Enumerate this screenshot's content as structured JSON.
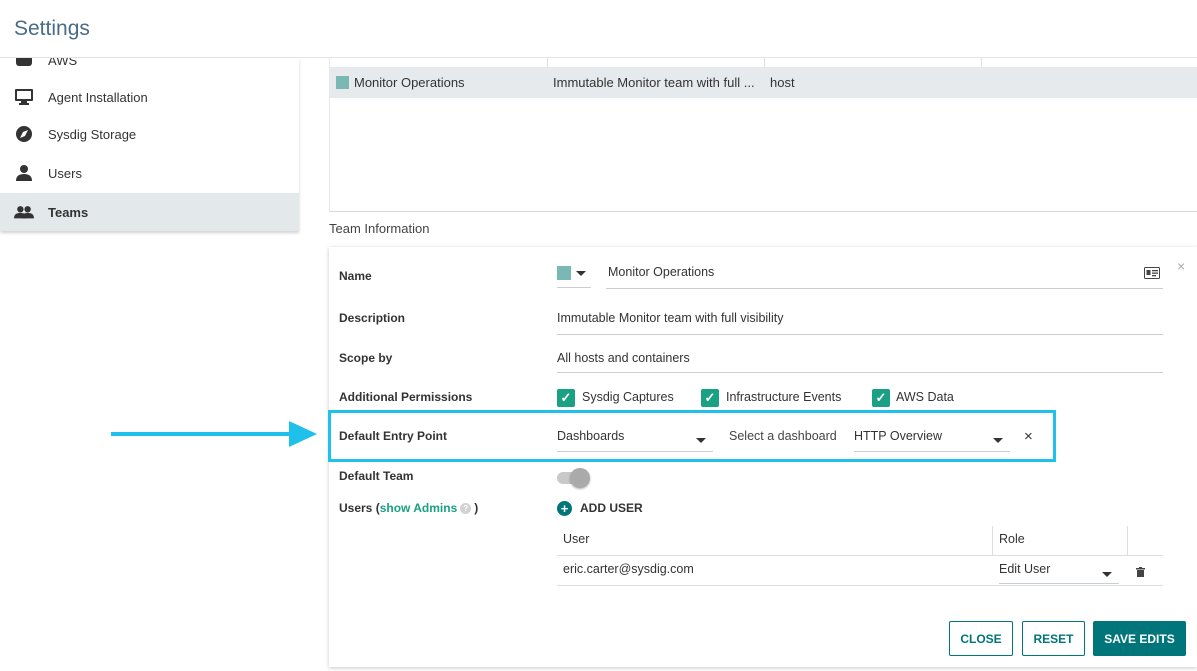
{
  "header": {
    "title": "Settings"
  },
  "sidebar": {
    "items": [
      {
        "label": "AWS",
        "icon": "aws-icon"
      },
      {
        "label": "Agent Installation",
        "icon": "monitor-icon"
      },
      {
        "label": "Sysdig Storage",
        "icon": "storage-icon"
      },
      {
        "label": "Users",
        "icon": "user-icon"
      },
      {
        "label": "Teams",
        "icon": "group-icon",
        "active": true
      }
    ]
  },
  "teams_table": {
    "rows": [
      {
        "name": "Monitor Operations",
        "description": "Immutable Monitor team with full ...",
        "scope": "host",
        "color": "#7ab8b6"
      }
    ]
  },
  "team_info": {
    "section_title": "Team Information",
    "name_label": "Name",
    "name_value": "Monitor Operations",
    "team_color": "#7ab8b6",
    "description_label": "Description",
    "description_value": "Immutable Monitor team with full visibility",
    "scope_label": "Scope by",
    "scope_value": "All hosts and containers",
    "permissions_label": "Additional Permissions",
    "permissions": [
      {
        "label": "Sysdig Captures",
        "checked": true
      },
      {
        "label": "Infrastructure Events",
        "checked": true
      },
      {
        "label": "AWS Data",
        "checked": true
      }
    ],
    "entry_point_label": "Default Entry Point",
    "entry_point_value": "Dashboards",
    "select_dashboard_label": "Select a dashboard",
    "dashboard_value": "HTTP Overview",
    "clear_symbol": "×",
    "default_team_label": "Default Team",
    "default_team_on": false,
    "users_label_prefix": "Users (",
    "users_label_link": "show Admins",
    "users_label_suffix": ")",
    "help_symbol": "?",
    "add_user_label": "ADD USER",
    "users_table": {
      "columns": [
        "User",
        "Role"
      ],
      "rows": [
        {
          "user": "eric.carter@sysdig.com",
          "role": "Edit User"
        }
      ]
    },
    "close_symbol": "×"
  },
  "buttons": {
    "close": "CLOSE",
    "reset": "RESET",
    "save": "SAVE EDITS"
  },
  "colors": {
    "accent": "#00757a",
    "check": "#1aa084",
    "highlight": "#1fc1ec"
  }
}
